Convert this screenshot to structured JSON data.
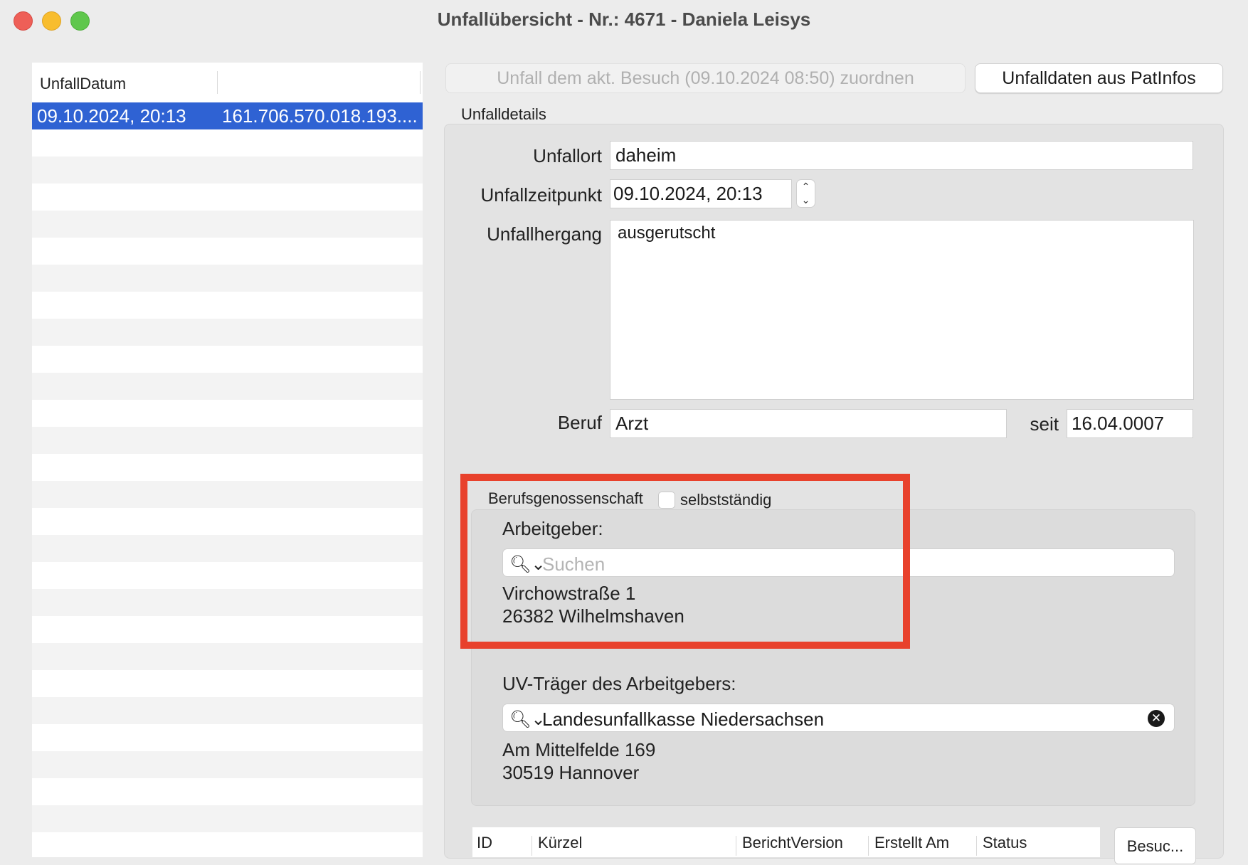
{
  "window": {
    "title": "Unfallübersicht - Nr.: 4671 - Daniela Leisys"
  },
  "accident_list": {
    "columns": [
      "UnfallDatum",
      ""
    ],
    "rows": [
      {
        "date": "09.10.2024, 20:13",
        "id": "161.706.570.018.193...."
      }
    ]
  },
  "toolbar": {
    "assign_label": "Unfall dem akt. Besuch (09.10.2024 08:50) zuordnen",
    "patinfo_label": "Unfalldaten aus PatInfos"
  },
  "details": {
    "section_label": "Unfalldetails",
    "unfallort_label": "Unfallort",
    "unfallort_value": "daheim",
    "zeitpunkt_label": "Unfallzeitpunkt",
    "zeitpunkt_value": "09.10.2024, 20:13",
    "hergang_label": "Unfallhergang",
    "hergang_value": "ausgerutscht",
    "beruf_label": "Beruf",
    "beruf_value": "Arzt",
    "seit_label": "seit",
    "seit_value": "16.04.0007"
  },
  "berufsgenossenschaft": {
    "label": "Berufsgenossenschaft",
    "selbststaendig_label": "selbstständig",
    "selbststaendig_checked": false,
    "employer_label": "Arbeitgeber:",
    "employer_search_placeholder": "Suchen",
    "employer_street": "Virchowstraße 1",
    "employer_city": "26382 Wilhelmshaven",
    "uv_label": "UV-Träger des Arbeitgebers:",
    "uv_search_value": "Landesunfallkasse Niedersachsen",
    "uv_street": "Am Mittelfelde 169",
    "uv_city": "30519 Hannover"
  },
  "reports": {
    "columns": [
      "ID",
      "Kürzel",
      "BerichtVersion",
      "Erstellt Am",
      "Status"
    ],
    "besuch_label": "Besuc..."
  },
  "colors": {
    "selection": "#2f62d3",
    "highlight": "#e8412c"
  }
}
